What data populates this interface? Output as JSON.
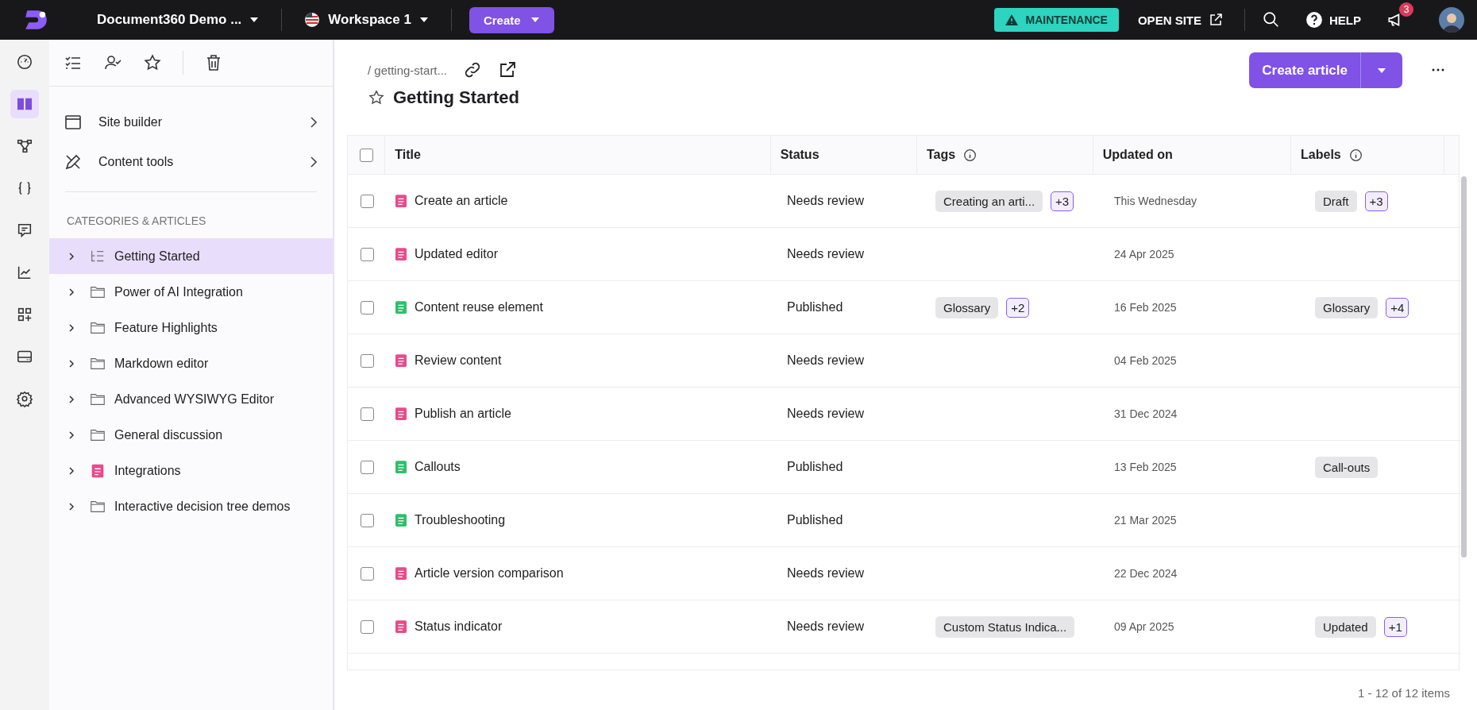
{
  "topbar": {
    "project": "Document360 Demo ...",
    "workspace": "Workspace 1",
    "create_button": "Create",
    "maintenance": "MAINTENANCE",
    "open_site": "OPEN SITE",
    "help": "HELP",
    "notification_count": "3"
  },
  "rail": [
    {
      "kind": "dashboard",
      "selected": false
    },
    {
      "kind": "book",
      "selected": true
    },
    {
      "kind": "hierarchy",
      "selected": false
    },
    {
      "kind": "braces",
      "selected": false
    },
    {
      "kind": "chat",
      "selected": false
    },
    {
      "kind": "chart",
      "selected": false
    },
    {
      "kind": "apps",
      "selected": false
    },
    {
      "kind": "drive",
      "selected": false
    },
    {
      "kind": "gear",
      "selected": false
    }
  ],
  "sidebar": {
    "links": [
      {
        "kind": "window",
        "label": "Site builder"
      },
      {
        "kind": "pencil",
        "label": "Content tools"
      }
    ],
    "section_title": "CATEGORIES & ARTICLES",
    "items": [
      {
        "kind": "index",
        "label": "Getting Started",
        "selected": true
      },
      {
        "kind": "folder",
        "label": "Power of AI Integration",
        "selected": false
      },
      {
        "kind": "folder",
        "label": "Feature Highlights",
        "selected": false
      },
      {
        "kind": "folder",
        "label": "Markdown editor",
        "selected": false
      },
      {
        "kind": "folder",
        "label": "Advanced WYSIWYG Editor",
        "selected": false
      },
      {
        "kind": "folder",
        "label": "General discussion",
        "selected": false
      },
      {
        "kind": "page",
        "label": "Integrations",
        "selected": false
      },
      {
        "kind": "folder",
        "label": "Interactive decision tree demos",
        "selected": false
      }
    ]
  },
  "page": {
    "breadcrumb": "/ getting-start...",
    "title": "Getting Started",
    "create_article": "Create article"
  },
  "table": {
    "select_all_checked": false,
    "columns": [
      {
        "label": "Title",
        "info": false
      },
      {
        "label": "Status",
        "info": false
      },
      {
        "label": "Tags",
        "info": true
      },
      {
        "label": "Updated on",
        "info": false
      },
      {
        "label": "Labels",
        "info": true
      }
    ],
    "rows": [
      {
        "checked": false,
        "color": "#e84b8a",
        "title": "Create an article",
        "status": "Needs review",
        "tags": [
          "Creating an arti...",
          "+3"
        ],
        "updated": "This Wednesday",
        "labels": [
          "Draft",
          "+3"
        ]
      },
      {
        "checked": false,
        "color": "#e84b8a",
        "title": "Updated editor",
        "status": "Needs review",
        "tags": [],
        "updated": "24 Apr 2025",
        "labels": []
      },
      {
        "checked": false,
        "color": "#2fbf6a",
        "title": "Content reuse element",
        "status": "Published",
        "tags": [
          "Glossary",
          "+2"
        ],
        "updated": "16 Feb 2025",
        "labels": [
          "Glossary",
          "+4"
        ]
      },
      {
        "checked": false,
        "color": "#e84b8a",
        "title": "Review content",
        "status": "Needs review",
        "tags": [],
        "updated": "04 Feb 2025",
        "labels": []
      },
      {
        "checked": false,
        "color": "#e84b8a",
        "title": "Publish an article",
        "status": "Needs review",
        "tags": [],
        "updated": "31 Dec 2024",
        "labels": []
      },
      {
        "checked": false,
        "color": "#2fbf6a",
        "title": "Callouts",
        "status": "Published",
        "tags": [],
        "updated": "13 Feb 2025",
        "labels": [
          "Call-outs"
        ]
      },
      {
        "checked": false,
        "color": "#2fbf6a",
        "title": "Troubleshooting",
        "status": "Published",
        "tags": [],
        "updated": "21 Mar 2025",
        "labels": []
      },
      {
        "checked": false,
        "color": "#e84b8a",
        "title": "Article version comparison",
        "status": "Needs review",
        "tags": [],
        "updated": "22 Dec 2024",
        "labels": []
      },
      {
        "checked": false,
        "color": "#e84b8a",
        "title": "Status indicator",
        "status": "Needs review",
        "tags": [
          "Custom Status Indica..."
        ],
        "updated": "09 Apr 2025",
        "labels": [
          "Updated",
          "+1"
        ]
      }
    ],
    "footer": "1 - 12 of 12 items"
  }
}
